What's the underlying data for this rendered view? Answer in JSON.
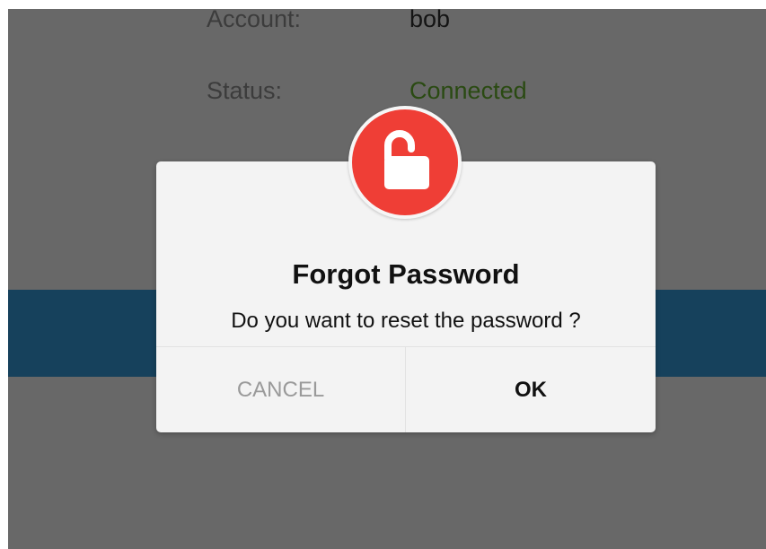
{
  "background_info": {
    "account_label": "Account:",
    "account_value": "bob",
    "status_label": "Status:",
    "status_value": "Connected"
  },
  "dialog": {
    "icon": "unlocked-padlock-icon",
    "title": "Forgot Password",
    "message": "Do you want to reset the password ?",
    "cancel_label": "CANCEL",
    "ok_label": "OK"
  },
  "colors": {
    "overlay": "#686868",
    "band": "#16415c",
    "badge": "#ef3e36",
    "status_text": "#2a4a12",
    "dialog_bg": "#f3f3f3"
  }
}
